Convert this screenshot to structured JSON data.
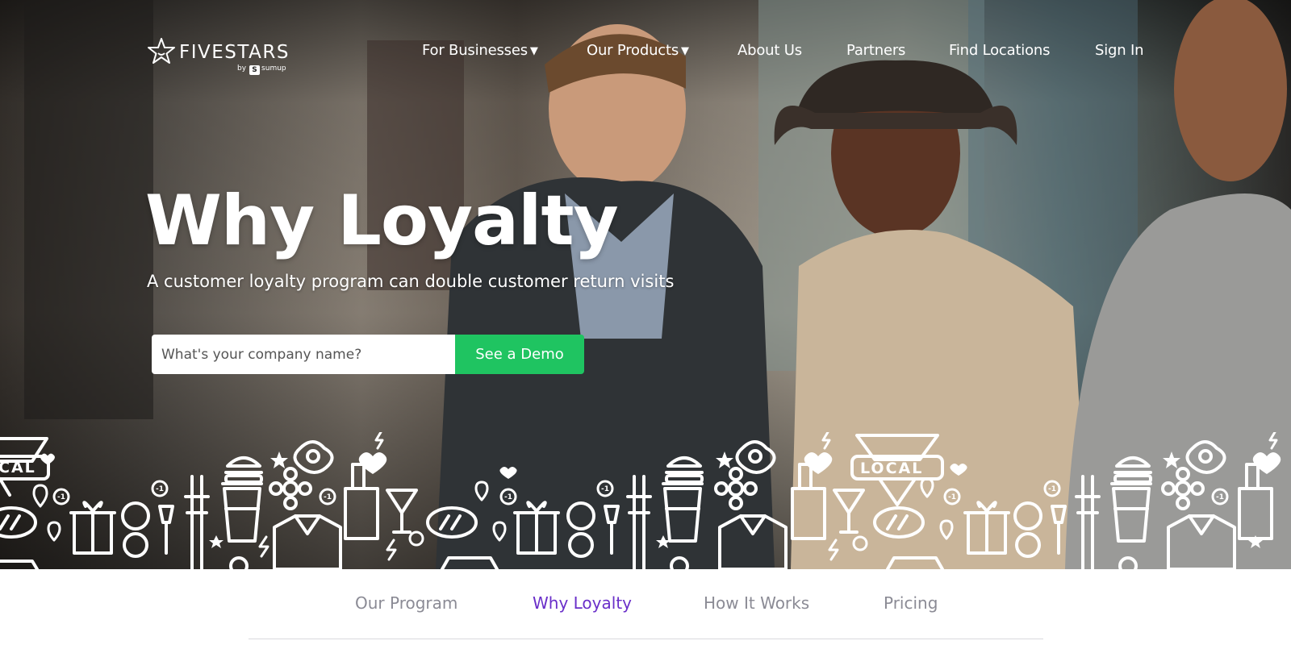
{
  "brand": {
    "name": "FIVESTARS",
    "by_text": "by",
    "partner": "sumup",
    "logo_icon": "star-badge-icon"
  },
  "nav": {
    "items": [
      {
        "label": "For Businesses",
        "dropdown": true
      },
      {
        "label": "Our Products",
        "dropdown": true
      },
      {
        "label": "About Us",
        "dropdown": false
      },
      {
        "label": "Partners",
        "dropdown": false
      },
      {
        "label": "Find Locations",
        "dropdown": false
      },
      {
        "label": "Sign In",
        "dropdown": false
      }
    ],
    "caret": "▼"
  },
  "hero": {
    "title": "Why Loyalty",
    "subtitle": "A customer loyalty program can double customer return visits",
    "input_placeholder": "What's your company name?",
    "cta_label": "See a Demo",
    "icon_strip_labels": [
      "LOCAL",
      "CAL"
    ],
    "icon_strip_badge": "-1"
  },
  "subnav": {
    "items": [
      {
        "label": "Our Program",
        "active": false
      },
      {
        "label": "Why Loyalty",
        "active": true
      },
      {
        "label": "How It Works",
        "active": false
      },
      {
        "label": "Pricing",
        "active": false
      }
    ]
  },
  "colors": {
    "accent_green": "#1fc461",
    "active_purple": "#6a2fc9",
    "inactive_gray": "#8b8b95",
    "white": "#ffffff"
  }
}
